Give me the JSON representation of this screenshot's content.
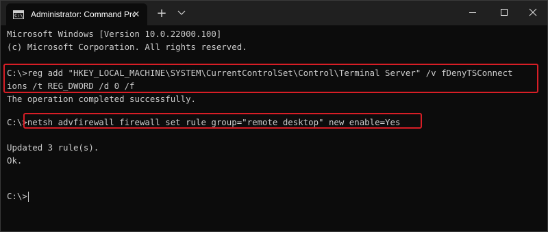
{
  "window": {
    "tab_title": "Administrator: Command Promp",
    "tab_icon_glyph": "C:\\",
    "new_tab_symbol": "+",
    "tab_close_symbol": "✕"
  },
  "console": {
    "lines": [
      "Microsoft Windows [Version 10.0.22000.100]",
      "(c) Microsoft Corporation. All rights reserved.",
      "C:\\>reg add \"HKEY_LOCAL_MACHINE\\SYSTEM\\CurrentControlSet\\Control\\Terminal Server\" /v fDenyTSConnect",
      "ions /t REG_DWORD /d 0 /f",
      "The operation completed successfully.",
      "C:\\>netsh advfirewall firewall set rule group=\"remote desktop\" new enable=Yes",
      "Updated 3 rule(s).",
      "Ok.",
      "C:\\>"
    ]
  },
  "colors": {
    "background": "#0c0c0c",
    "titlebar": "#202020",
    "text": "#cccccc",
    "highlight": "#d81e26"
  },
  "icons": {
    "tab": "cmd-icon",
    "close_tab": "close-icon",
    "new_tab": "plus-icon",
    "dropdown": "chevron-down-icon",
    "minimize": "minimize-icon",
    "maximize": "maximize-icon",
    "close_window": "close-icon"
  }
}
